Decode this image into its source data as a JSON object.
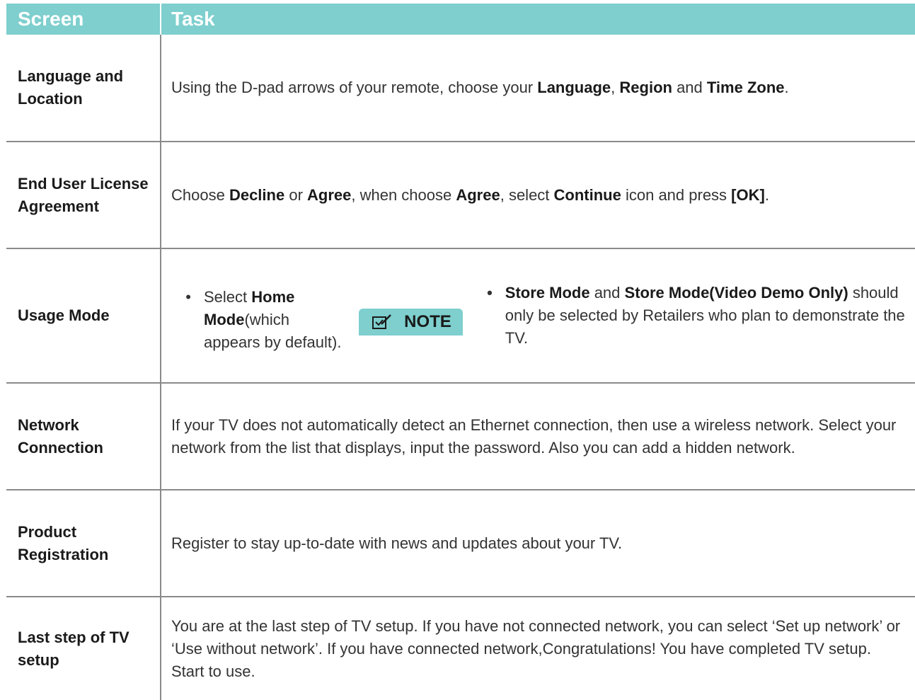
{
  "header": {
    "col1": "Screen",
    "col2": "Task"
  },
  "rows": [
    {
      "screen": [
        "Language and",
        "Location"
      ],
      "task": {
        "t1": "Using the D-pad arrows of your remote, choose your ",
        "b1": "Language",
        "t2": ", ",
        "b2": "Region",
        "t3": " and ",
        "b3": "Time Zone",
        "t4": "."
      }
    },
    {
      "screen": [
        "End User License",
        "Agreement"
      ],
      "task": {
        "t1": "Choose ",
        "b1": "Decline",
        "t2": " or ",
        "b2": "Agree",
        "t3": ", when choose ",
        "b3": "Agree",
        "t4": ", select ",
        "b4": "Continue",
        "t5": " icon and press ",
        "b5": "[OK]",
        "t6": "."
      }
    },
    {
      "screen": [
        "Usage Mode"
      ],
      "task": {
        "bullet1": {
          "t1": "Select ",
          "b1": "Home Mode",
          "t2": "(which appears by default)."
        },
        "note_label": "NOTE",
        "bullet2": {
          "b1": "Store Mode",
          "t1": " and ",
          "b2": "Store Mode(Video Demo Only)",
          "t2": " should only be selected by Retailers who plan to demonstrate the TV."
        }
      }
    },
    {
      "screen": [
        "Network",
        "Connection"
      ],
      "task": "If your TV does not automatically detect an Ethernet connection, then use a wireless network. Select your network from the list that displays, input the password. Also you can add a hidden network."
    },
    {
      "screen": [
        "Product",
        "Registration"
      ],
      "task": "Register to stay up-to-date with news and updates about your TV."
    },
    {
      "screen": [
        "Last step of TV",
        "setup"
      ],
      "task": "You are at the last step of TV setup. If you have not connected network, you can select ‘Set up network’ or ‘Use without network’. If you have connected network,Congratulations! You have completed TV setup. Start to use."
    }
  ],
  "icons": {
    "note": "checkbox-pencil-icon"
  },
  "colors": {
    "header_bg": "#7ecfce",
    "divider": "#8a8a8a"
  }
}
